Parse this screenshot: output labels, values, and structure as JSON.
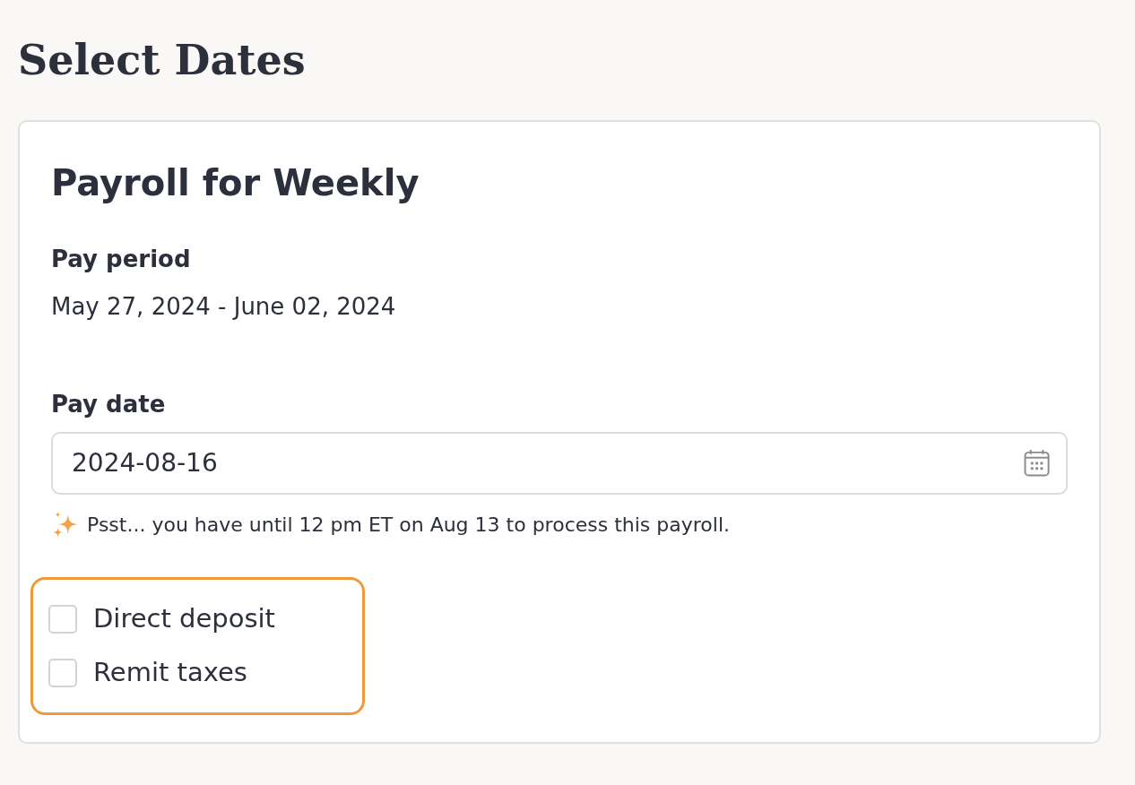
{
  "page": {
    "title": "Select Dates"
  },
  "card": {
    "title": "Payroll for Weekly",
    "pay_period": {
      "label": "Pay period",
      "value": "May 27, 2024 - June 02, 2024"
    },
    "pay_date": {
      "label": "Pay date",
      "value": "2024-08-16"
    },
    "hint": "Psst... you have until 12 pm ET on Aug 13 to process this payroll.",
    "options_highlighted": true,
    "options": [
      {
        "label": "Direct deposit",
        "checked": false
      },
      {
        "label": "Remit taxes",
        "checked": false
      }
    ]
  }
}
